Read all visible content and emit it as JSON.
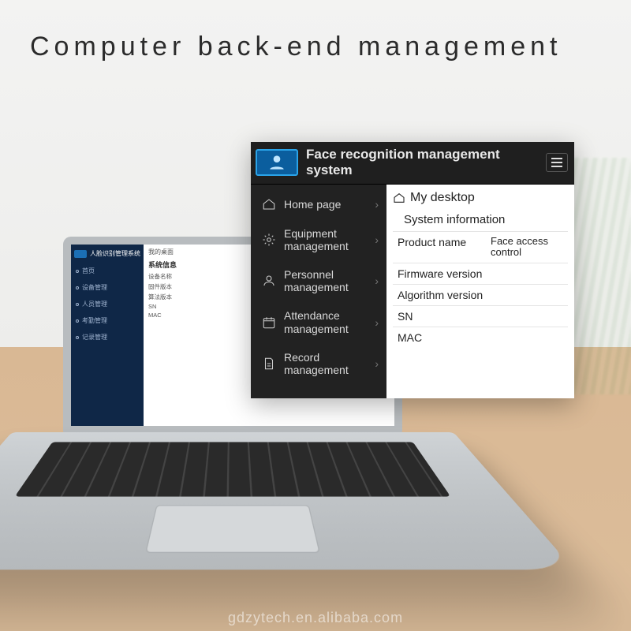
{
  "page": {
    "title": "Computer back-end management"
  },
  "mini": {
    "app_title": "人脸识别管理系统",
    "tab": "我的桌面",
    "section": "系统信息",
    "rows": [
      "设备名称",
      "固件版本",
      "算法版本",
      "SN",
      "MAC"
    ],
    "nav": [
      "首页",
      "设备管理",
      "人员管理",
      "考勤管理",
      "记录管理"
    ]
  },
  "panel": {
    "title": "Face recognition management system",
    "nav": [
      {
        "icon": "home",
        "label": "Home page"
      },
      {
        "icon": "gear",
        "label": "Equipment management"
      },
      {
        "icon": "user",
        "label": "Personnel management"
      },
      {
        "icon": "calendar",
        "label": "Attendance management"
      },
      {
        "icon": "doc",
        "label": "Record management"
      }
    ],
    "crumb": "My desktop",
    "card_title": "System information",
    "info": [
      {
        "k": "Product name",
        "v": "Face access control"
      },
      {
        "k": "Firmware version",
        "v": ""
      },
      {
        "k": "Algorithm version",
        "v": ""
      },
      {
        "k": "SN",
        "v": ""
      },
      {
        "k": "MAC",
        "v": ""
      }
    ]
  },
  "watermark": "gdzytech.en.alibaba.com"
}
